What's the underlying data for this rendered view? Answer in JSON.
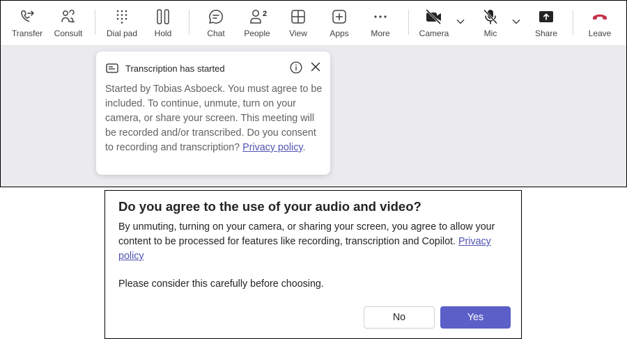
{
  "toolbar": {
    "transfer": "Transfer",
    "consult": "Consult",
    "dialpad": "Dial pad",
    "hold": "Hold",
    "chat": "Chat",
    "people": "People",
    "people_count": "2",
    "view": "View",
    "apps": "Apps",
    "more": "More",
    "camera": "Camera",
    "mic": "Mic",
    "share": "Share",
    "leave": "Leave"
  },
  "popup": {
    "title": "Transcription has started",
    "body": "Started by Tobias Asboeck. You must agree to be included. To continue, unmute, turn on your camera, or share your screen. This meeting will be recorded and/or transcribed. Do you consent to recording and transcription? ",
    "link": "Privacy policy",
    "end": "."
  },
  "dialog": {
    "title": "Do you agree to the use of your audio and video?",
    "text": "By unmuting, turning on your camera, or sharing your screen, you agree to allow your content to be processed for features like recording, transcription and Copilot. ",
    "link": "Privacy policy",
    "note": "Please consider this carefully before choosing.",
    "no": "No",
    "yes": "Yes"
  },
  "colors": {
    "accent": "#5b5fc7",
    "link": "#4f52b2",
    "leave": "#c4314b"
  }
}
